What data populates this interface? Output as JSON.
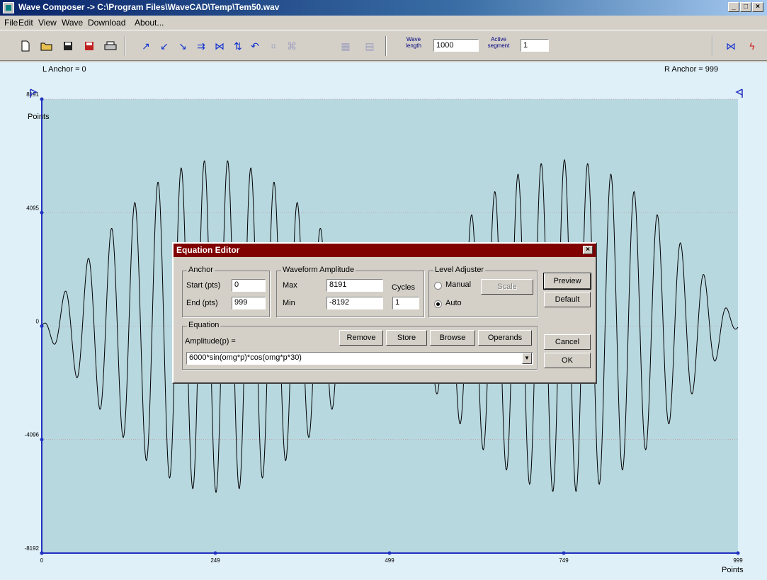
{
  "window": {
    "title": "Wave Composer -> C:\\Program Files\\WaveCAD\\Temp\\Tem50.wav"
  },
  "menu": [
    "File",
    "Edit",
    "View",
    "Wave",
    "Download",
    "About..."
  ],
  "toolbar": {
    "icons": [
      "new-file-icon",
      "open-folder-icon",
      "save-icon",
      "save-as-icon",
      "print-icon",
      "wave-tool-1-icon",
      "wave-tool-2-icon",
      "wave-tool-3-icon",
      "wave-tool-4-icon",
      "wave-tool-5-icon",
      "wave-tool-6-icon",
      "undo-icon",
      "wave-tool-7-icon",
      "wave-tool-8-icon",
      "wave-tool-9-icon",
      "wave-tool-10-icon"
    ],
    "wave_length_label": "Wave length",
    "wave_length_value": "1000",
    "active_segment_label": "Active segment",
    "active_segment_value": "1"
  },
  "plot": {
    "left_anchor": "L Anchor = 0",
    "right_anchor": "R Anchor = 999",
    "y_unit": "Points",
    "x_unit": "Points"
  },
  "chart_data": {
    "type": "line",
    "equation": "6000*sin(omg*p)*cos(omg*p*30)",
    "x_range": [
      0,
      999
    ],
    "y_range": [
      -8192,
      8191
    ],
    "y_ticks": [
      "8191",
      "4095",
      "0",
      "-4096",
      "-8192"
    ],
    "x_ticks": [
      "0",
      "249",
      "499",
      "749",
      "999"
    ],
    "gridlines": true
  },
  "dialog": {
    "title": "Equation Editor",
    "anchor": {
      "label": "Anchor",
      "start_label": "Start (pts)",
      "start_value": "0",
      "end_label": "End (pts)",
      "end_value": "999"
    },
    "amplitude": {
      "label": "Waveform Amplitude",
      "max_label": "Max",
      "max_value": "8191",
      "min_label": "Min",
      "min_value": "-8192",
      "cycles_label": "Cycles",
      "cycles_value": "1"
    },
    "level": {
      "label": "Level Adjuster",
      "manual_label": "Manual",
      "auto_label": "Auto",
      "scale_label": "Scale"
    },
    "equation": {
      "label": "Equation",
      "amplitude_label": "Amplitude(p) =",
      "value": "6000*sin(omg*p)*cos(omg*p*30)"
    },
    "buttons": {
      "remove": "Remove",
      "store": "Store",
      "browse": "Browse",
      "operands": "Operands",
      "preview": "Preview",
      "default": "Default",
      "cancel": "Cancel",
      "ok": "OK"
    }
  }
}
